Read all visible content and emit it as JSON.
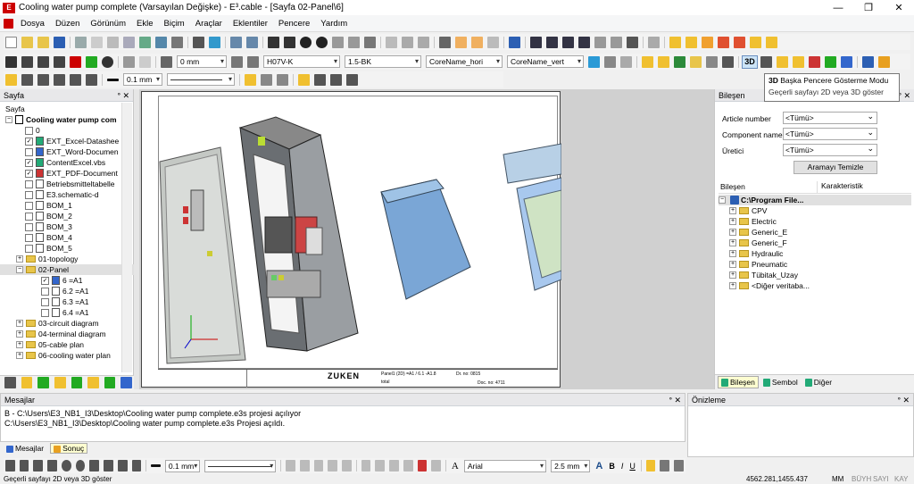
{
  "window": {
    "title": "Cooling water pump complete (Varsayılan Değişke) - E³.cable - [Sayfa 02-Panel\\6]",
    "logo": "E"
  },
  "menu": [
    "Dosya",
    "Düzen",
    "Görünüm",
    "Ekle",
    "Biçim",
    "Araçlar",
    "Eklentiler",
    "Pencere",
    "Yardım"
  ],
  "toolbar": {
    "offset_value": "0 mm",
    "wire_type": "H07V-K",
    "wire_color": "1.5-BK",
    "core_h": "CoreName_hori",
    "core_v": "CoreName_vert",
    "line_width": "0.1 mm",
    "toggle_3d": "3D"
  },
  "tooltip": {
    "title": "Başka Pencere Gösterme Modu",
    "desc": "Geçerli sayfayı 2D veya 3D göster"
  },
  "left_panel": {
    "title": "Sayfa",
    "root_label": "Sayfa",
    "project": "Cooling water pump com",
    "items": [
      "0",
      "EXT_Excel-Datashee",
      "EXT_Word-Documen",
      "ContentExcel.vbs",
      "EXT_PDF-Document",
      "Betriebsmitteltabelle",
      "E3.schematic-d",
      "BOM_1",
      "BOM_2",
      "BOM_3",
      "BOM_4",
      "BOM_5",
      "01-topology",
      "02-Panel",
      "6 =A1",
      "6.2 =A1",
      "6.3 =A1",
      "6.4 =A1",
      "03-circuit diagram",
      "04-terminal diagram",
      "05-cable plan",
      "06-cooling water plan"
    ]
  },
  "right_panel": {
    "title": "Bileşen",
    "labels": [
      "Article number",
      "Component name",
      "Üretici"
    ],
    "combo_value": "<Tümü>",
    "clear_button": "Aramayı Temizle",
    "col1": "Bileşen",
    "col2": "Karakteristik",
    "root": "C:\\Program File...",
    "folders": [
      "CPV",
      "Electric",
      "Generic_E",
      "Generic_F",
      "Hydraulic",
      "Pneumatic",
      "Tübitak_Uzay",
      "<Diğer veritaba..."
    ],
    "tabs": [
      "Bileşen",
      "Sembol",
      "Diğer"
    ]
  },
  "messages": {
    "title": "Mesajlar",
    "lines": [
      "B -  C:\\Users\\E3_NB1_I3\\Desktop\\Cooling water pump complete.e3s projesi açılıyor",
      "C:\\Users\\E3_NB1_I3\\Desktop\\Cooling water pump complete.e3s Projesi açıldı."
    ],
    "tabs": [
      "Mesajlar",
      "Sonuç"
    ]
  },
  "preview": {
    "title": "Önizleme"
  },
  "drawing": {
    "brand": "ZUKEN",
    "doc_no": "Doc. no: 4711",
    "page": "Panel1 (2D) =A1 / 6.1 -A1.8",
    "date": "Dr. no: 0815",
    "total": "total"
  },
  "bottom_toolbar": {
    "line_width": "0.1 mm",
    "font": "Arial",
    "font_size": "2.5 mm"
  },
  "status": {
    "left": "Geçerli sayfayı 2D veya 3D göster",
    "coords": "4562.281,1455.437",
    "unit": "MM",
    "modes": [
      "BÜYH",
      "SAYI",
      "KAY"
    ]
  },
  "colors": {
    "accent": "#1f4e8c",
    "selected": "#cce4f7"
  }
}
